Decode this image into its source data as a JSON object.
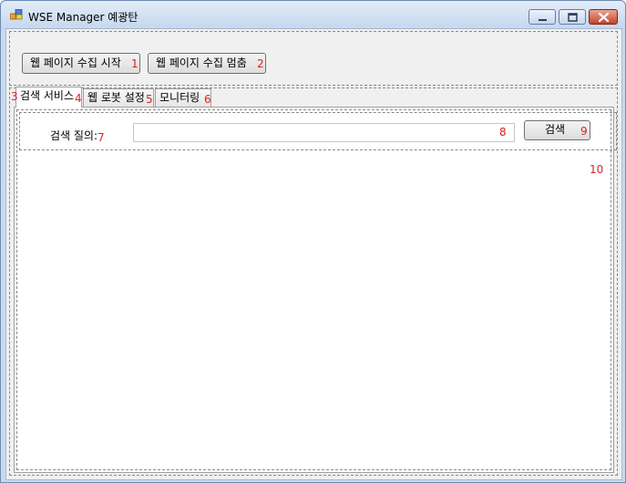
{
  "window": {
    "title": "WSE Manager 예광탄"
  },
  "toolbar": {
    "start_label": "웹 페이지 수집 시작",
    "start_tag": "1",
    "stop_label": "웹 페이지 수집 멈춤",
    "stop_tag": "2"
  },
  "tabs": {
    "container_tag": "3",
    "items": [
      {
        "label": "검색 서비스",
        "tag": "4",
        "active": true
      },
      {
        "label": "웹 로봇 설정",
        "tag": "5",
        "active": false
      },
      {
        "label": "모니터링",
        "tag": "6",
        "active": false
      }
    ]
  },
  "search": {
    "label": "검색 질의:",
    "label_tag": "7",
    "input_value": "",
    "input_tag": "8",
    "button_label": "검색",
    "button_tag": "9"
  },
  "results": {
    "tag": "10"
  },
  "colors": {
    "tag_number": "#e02020",
    "close_button": "#c3432b",
    "title_bar": "#c5d8ee"
  }
}
